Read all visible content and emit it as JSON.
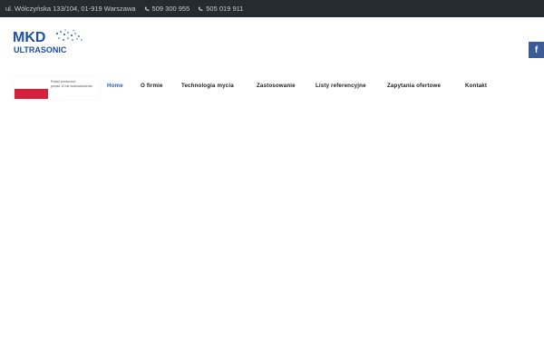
{
  "topbar": {
    "address": "ul. Wólczyńska 133/104, 01-919 Warszawa",
    "phone1": "509 300 955",
    "phone2": "505 019 911"
  },
  "logo": {
    "line1": "MKD",
    "line2": "ULTRASONIC",
    "color": "#1f4fa6"
  },
  "social": {
    "icon": "facebook-icon",
    "label": "f",
    "color": "#3b5b99"
  },
  "badge": {
    "line1": "Polski producent,",
    "line2": "ponad 10 lat doświadczenia"
  },
  "nav": [
    {
      "label": "Home",
      "active": true
    },
    {
      "label": "O firmie"
    },
    {
      "label": "Technologia mycia"
    },
    {
      "label": "Zastosowanie"
    },
    {
      "label": "Listy referencyjne"
    },
    {
      "label": "Zapytania ofertowe"
    },
    {
      "label": "Kontakt"
    }
  ],
  "accent": "#2f5ec4"
}
